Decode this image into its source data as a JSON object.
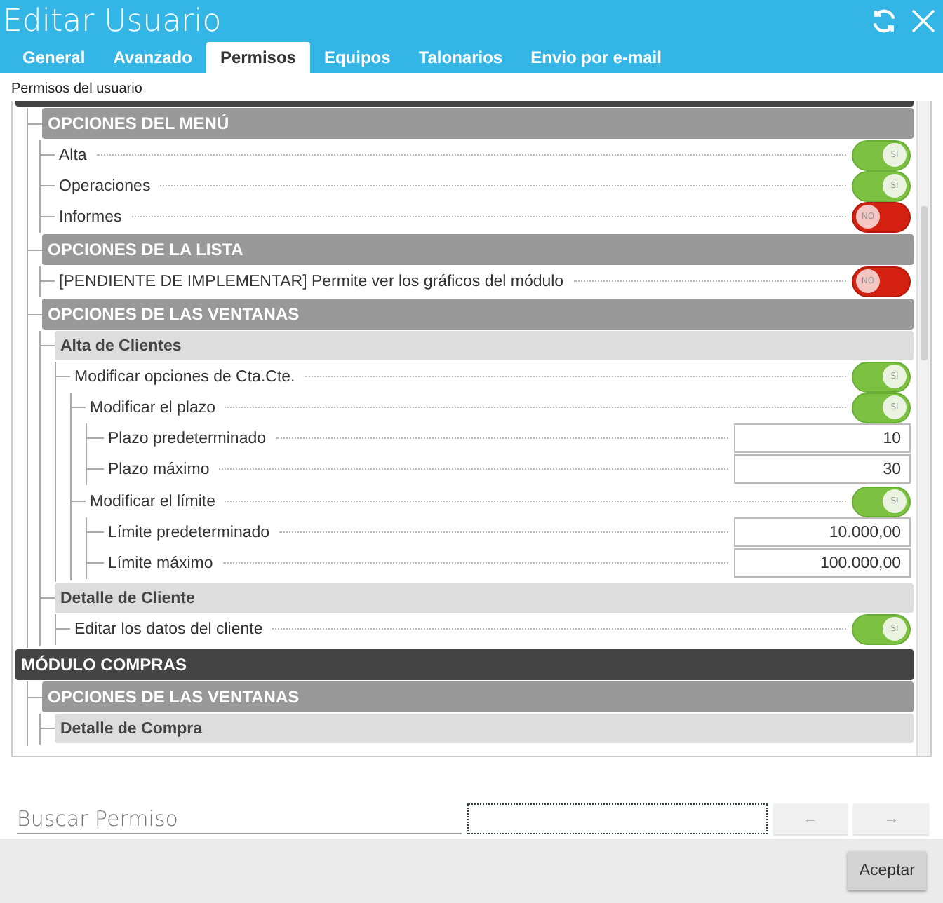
{
  "window": {
    "title": "Editar Usuario"
  },
  "tabs": [
    {
      "label": "General",
      "selected": false
    },
    {
      "label": "Avanzado",
      "selected": false
    },
    {
      "label": "Permisos",
      "selected": true
    },
    {
      "label": "Equipos",
      "selected": false
    },
    {
      "label": "Talonarios",
      "selected": false
    },
    {
      "label": "Envio por e-mail",
      "selected": false
    }
  ],
  "panel_label": "Permisos del usuario",
  "tree": [
    {
      "kind": "module",
      "children": [
        {
          "kind": "section",
          "label": "OPCIONES DEL MENÚ",
          "children": [
            {
              "kind": "toggle",
              "label": "Alta",
              "on": true,
              "text": "SI"
            },
            {
              "kind": "toggle",
              "label": "Operaciones",
              "on": true,
              "text": "SI"
            },
            {
              "kind": "toggle",
              "label": "Informes",
              "on": false,
              "text": "NO"
            }
          ]
        },
        {
          "kind": "section",
          "label": "OPCIONES DE LA LISTA",
          "children": [
            {
              "kind": "toggle",
              "label": "[PENDIENTE DE IMPLEMENTAR] Permite ver los gráficos del módulo",
              "on": false,
              "text": "NO"
            }
          ]
        },
        {
          "kind": "section",
          "label": "OPCIONES DE LAS VENTANAS",
          "children": [
            {
              "kind": "group",
              "label": "Alta de Clientes",
              "children": [
                {
                  "kind": "toggle",
                  "label": "Modificar opciones de Cta.Cte.",
                  "on": true,
                  "text": "SI",
                  "children": [
                    {
                      "kind": "toggle",
                      "label": "Modificar el plazo",
                      "on": true,
                      "text": "SI",
                      "children": [
                        {
                          "kind": "value",
                          "label": "Plazo predeterminado",
                          "value": "10"
                        },
                        {
                          "kind": "value",
                          "label": "Plazo máximo",
                          "value": "30"
                        }
                      ]
                    },
                    {
                      "kind": "toggle",
                      "label": "Modificar el límite",
                      "on": true,
                      "text": "SI",
                      "children": [
                        {
                          "kind": "value",
                          "label": "Límite predeterminado",
                          "value": "10.000,00"
                        },
                        {
                          "kind": "value",
                          "label": "Límite máximo",
                          "value": "100.000,00"
                        }
                      ]
                    }
                  ]
                }
              ]
            },
            {
              "kind": "group",
              "label": "Detalle de Cliente",
              "children": [
                {
                  "kind": "toggle",
                  "label": "Editar los datos del cliente",
                  "on": true,
                  "text": "SI"
                }
              ]
            }
          ]
        }
      ]
    },
    {
      "kind": "module",
      "label": "MÓDULO COMPRAS",
      "children": [
        {
          "kind": "section",
          "label": "OPCIONES DE LAS VENTANAS",
          "children": [
            {
              "kind": "group",
              "label": "Detalle de Compra"
            }
          ]
        }
      ]
    }
  ],
  "search": {
    "label": "Buscar Permiso",
    "prev": "←",
    "next": "→"
  },
  "footer": {
    "accept": "Aceptar"
  }
}
